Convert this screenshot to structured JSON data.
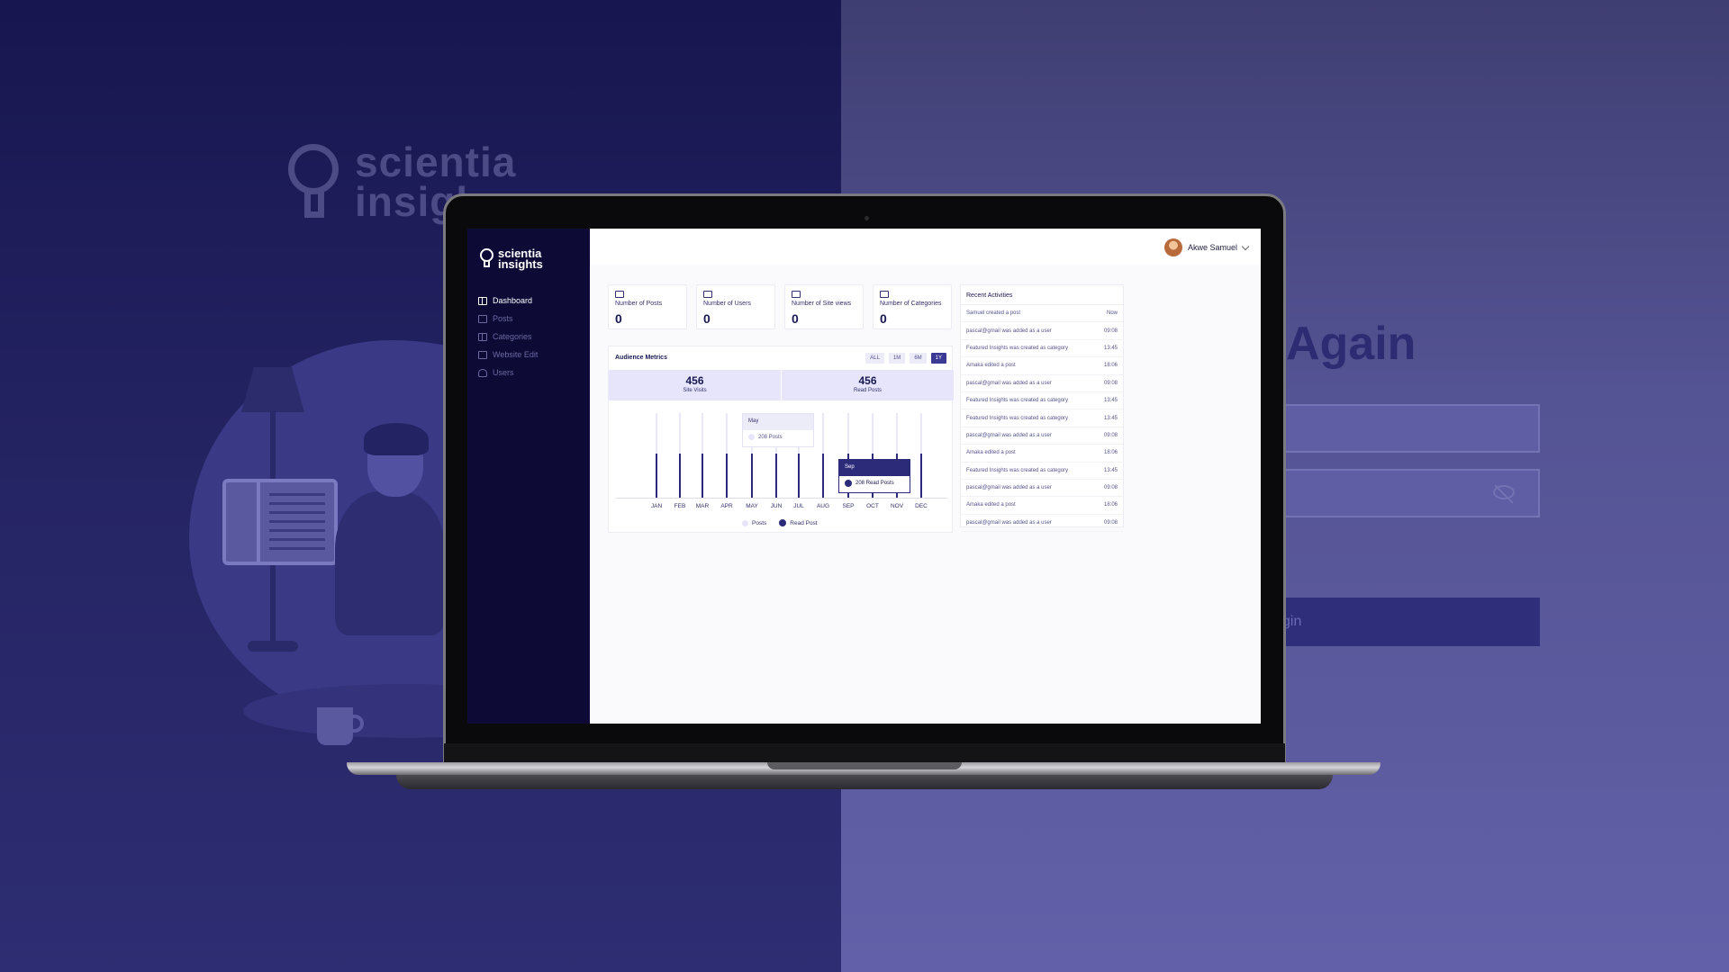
{
  "background": {
    "logo_lines": [
      "scientia",
      "insigh"
    ],
    "heading": "Again",
    "login_button": "gin"
  },
  "sidebar": {
    "logo_lines": [
      "scientia",
      "insights"
    ],
    "items": [
      {
        "label": "Dashboard",
        "icon": "dashboard-icon",
        "active": true
      },
      {
        "label": "Posts",
        "icon": "posts-icon",
        "active": false
      },
      {
        "label": "Categories",
        "icon": "categories-icon",
        "active": false
      },
      {
        "label": "Website Edit",
        "icon": "monitor-icon",
        "active": false
      },
      {
        "label": "Users",
        "icon": "users-icon",
        "active": false
      }
    ]
  },
  "header": {
    "user_name": "Akwe Samuel"
  },
  "stats": [
    {
      "label": "Number of Posts",
      "value": "0",
      "icon": "calendar-icon"
    },
    {
      "label": "Number of Users",
      "value": "0",
      "icon": "users-icon"
    },
    {
      "label": "Number of Site views",
      "value": "0",
      "icon": "monitor-icon"
    },
    {
      "label": "Number of Categories",
      "value": "0",
      "icon": "categories-icon"
    }
  ],
  "audience": {
    "title": "Audience Metrics",
    "filters": [
      "ALL",
      "1M",
      "6M",
      "1Y"
    ],
    "active_filter": "1Y",
    "site_visits": {
      "value": "456",
      "label": "Site Visits"
    },
    "read_posts": {
      "value": "456",
      "label": "Read Posts"
    }
  },
  "chart_data": {
    "type": "bar",
    "categories": [
      "JAN",
      "FEB",
      "MAR",
      "APR",
      "MAY",
      "JUN",
      "JUL",
      "AUG",
      "SEP",
      "OCT",
      "NOV",
      "DEC"
    ],
    "series": [
      {
        "name": "Posts",
        "values": [
          1,
          1,
          1,
          1,
          1,
          1,
          1,
          1,
          1,
          1,
          1,
          1
        ]
      },
      {
        "name": "Read Post",
        "values": [
          0.52,
          0.52,
          0.52,
          0.52,
          0.52,
          0.52,
          0.52,
          0.52,
          0.52,
          0.52,
          0.52,
          0.52
        ]
      }
    ],
    "tooltips": [
      {
        "month": "May",
        "text": "208 Posts"
      },
      {
        "month": "Sep",
        "text": "208 Read Posts"
      }
    ],
    "legend": [
      "Posts",
      "Read Post"
    ],
    "legend_position": "bottom",
    "colors": {
      "posts": "#e9e8f6",
      "read_post": "#2c2b7a"
    }
  },
  "activities": {
    "title": "Recent Activities",
    "items": [
      {
        "text": "Samuel created a post",
        "time": "Now"
      },
      {
        "text": "pascal@gmail was added as a user",
        "time": "09:08"
      },
      {
        "text": "Featured Insights was created as category",
        "time": "13:45"
      },
      {
        "text": "Amaka edited a post",
        "time": "18:06"
      },
      {
        "text": "pascal@gmail was added as a user",
        "time": "09:08"
      },
      {
        "text": "Featured Insights was created as category",
        "time": "13:45"
      },
      {
        "text": "Featured Insights was created as category",
        "time": "13:45"
      },
      {
        "text": "pascal@gmail was added as a user",
        "time": "09:08"
      },
      {
        "text": "Amaka edited a post",
        "time": "18:06"
      },
      {
        "text": "Featured Insights was created as category",
        "time": "13:45"
      },
      {
        "text": "pascal@gmail was added as a user",
        "time": "09:08"
      },
      {
        "text": "Amaka edited a post",
        "time": "18:06"
      },
      {
        "text": "pascal@gmail was added as a user",
        "time": "09:08"
      }
    ]
  },
  "colors": {
    "sidebar": "#0d0b36",
    "accent": "#3a3994",
    "bg_left": "#242362",
    "bg_right": "#545393"
  }
}
